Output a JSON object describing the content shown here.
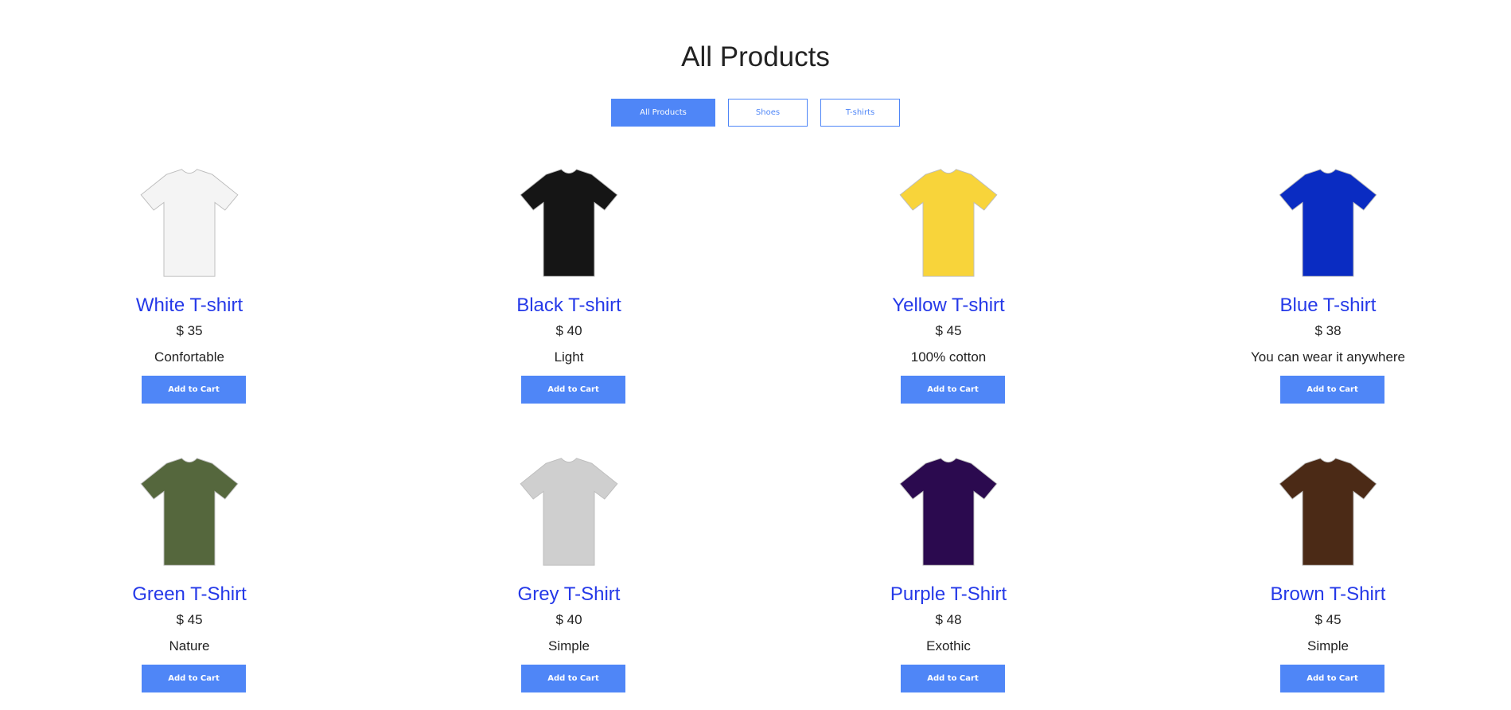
{
  "page": {
    "title": "All Products"
  },
  "filters": [
    {
      "label": "All Products",
      "active": true
    },
    {
      "label": "Shoes",
      "active": false
    },
    {
      "label": "T-shirts",
      "active": false
    }
  ],
  "products": [
    {
      "name": "White T-shirt",
      "price": "$ 35",
      "description": "Confortable",
      "button": "Add to Cart",
      "color": "#f4f4f4",
      "icon": "tshirt-icon"
    },
    {
      "name": "Black T-shirt",
      "price": "$ 40",
      "description": "Light",
      "button": "Add to Cart",
      "color": "#151515",
      "icon": "tshirt-icon"
    },
    {
      "name": "Yellow T-shirt",
      "price": "$ 45",
      "description": "100% cotton",
      "button": "Add to Cart",
      "color": "#f8d43a",
      "icon": "tshirt-icon"
    },
    {
      "name": "Blue T-shirt",
      "price": "$ 38",
      "description": "You can wear it anywhere",
      "button": "Add to Cart",
      "color": "#0a2cc2",
      "icon": "tshirt-icon"
    },
    {
      "name": "Green T-Shirt",
      "price": "$ 45",
      "description": "Nature",
      "button": "Add to Cart",
      "color": "#55673d",
      "icon": "tshirt-icon"
    },
    {
      "name": "Grey T-Shirt",
      "price": "$ 40",
      "description": "Simple",
      "button": "Add to Cart",
      "color": "#cfcfcf",
      "icon": "tshirt-icon"
    },
    {
      "name": "Purple T-Shirt",
      "price": "$ 48",
      "description": "Exothic",
      "button": "Add to Cart",
      "color": "#2b0a4f",
      "icon": "tshirt-icon"
    },
    {
      "name": "Brown T-Shirt",
      "price": "$ 45",
      "description": "Simple",
      "button": "Add to Cart",
      "color": "#4b2a16",
      "icon": "tshirt-icon"
    }
  ],
  "colors": {
    "accent": "#4f86f7",
    "product_name": "#2539e8"
  }
}
